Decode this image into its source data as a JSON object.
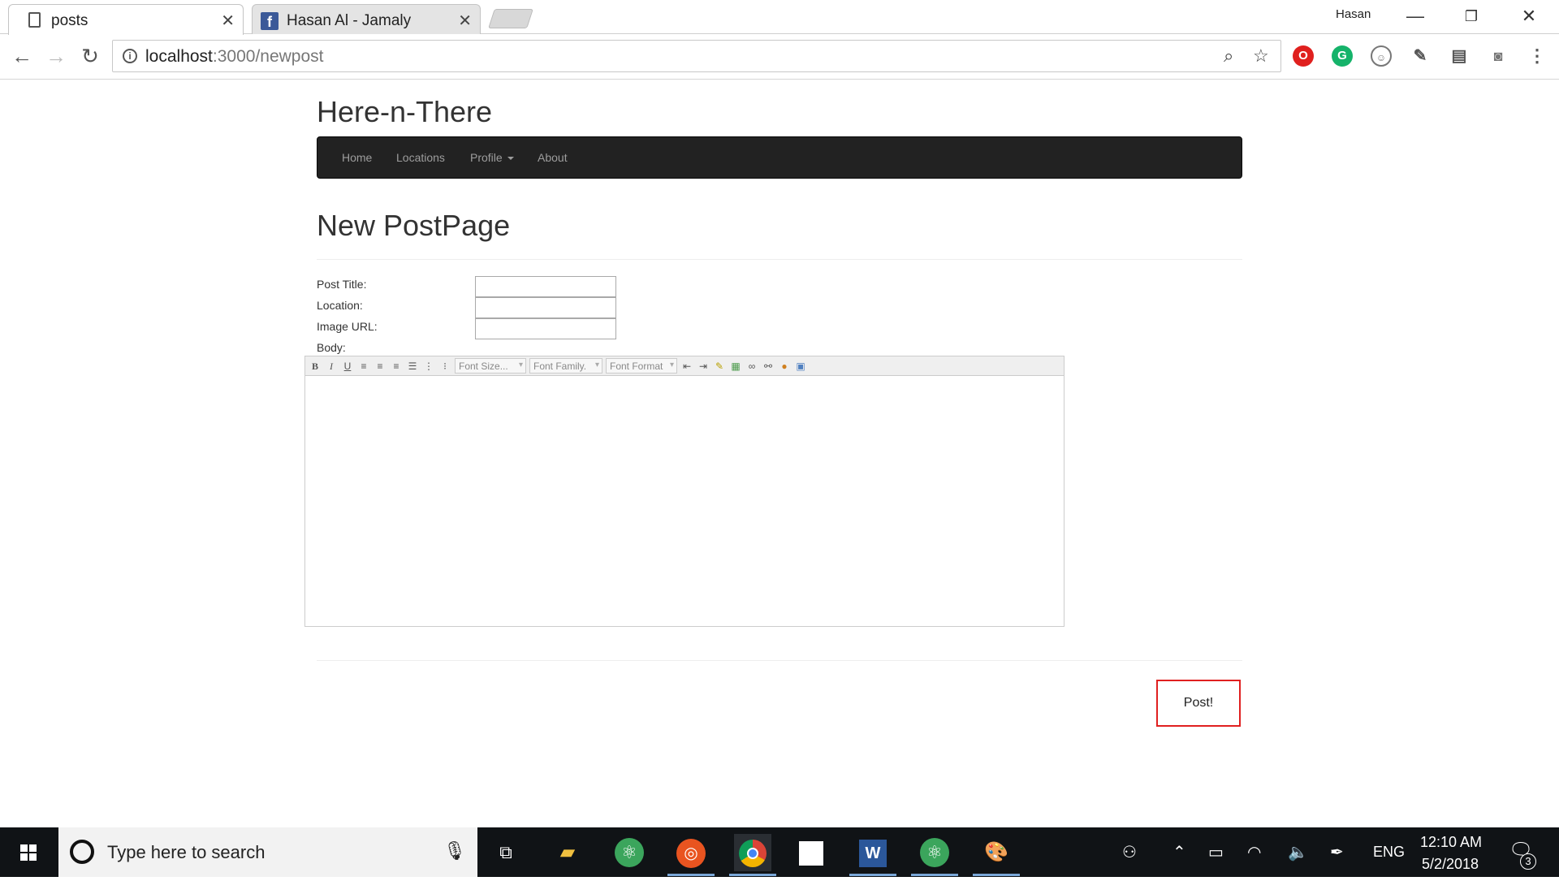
{
  "browser": {
    "tabs": [
      {
        "title": "posts",
        "active": true,
        "icon": "page-icon"
      },
      {
        "title": "Hasan Al - Jamaly",
        "active": false,
        "icon": "facebook-icon"
      }
    ],
    "profile_name": "Hasan",
    "url_host": "localhost",
    "url_rest": ":3000/newpost"
  },
  "site": {
    "brand": "Here-n-There",
    "nav": {
      "home": "Home",
      "locations": "Locations",
      "profile": "Profile",
      "about": "About"
    }
  },
  "form": {
    "header": "New PostPage",
    "labels": {
      "title": "Post Title:",
      "location": "Location:",
      "image_url": "Image URL:",
      "body": "Body:"
    },
    "values": {
      "title": "",
      "location": "",
      "image_url": ""
    },
    "editor": {
      "font_size": "Font Size...",
      "font_family": "Font Family.",
      "font_format": "Font Format"
    },
    "submit_label": "Post!"
  },
  "taskbar": {
    "search_placeholder": "Type here to search",
    "language": "ENG",
    "time": "12:10 AM",
    "date": "5/2/2018",
    "notification_count": "3"
  },
  "colors": {
    "navbar_bg": "#222222",
    "nav_link": "#9d9d9d",
    "post_button_border": "#e02020",
    "taskbar_bg": "#101316"
  }
}
